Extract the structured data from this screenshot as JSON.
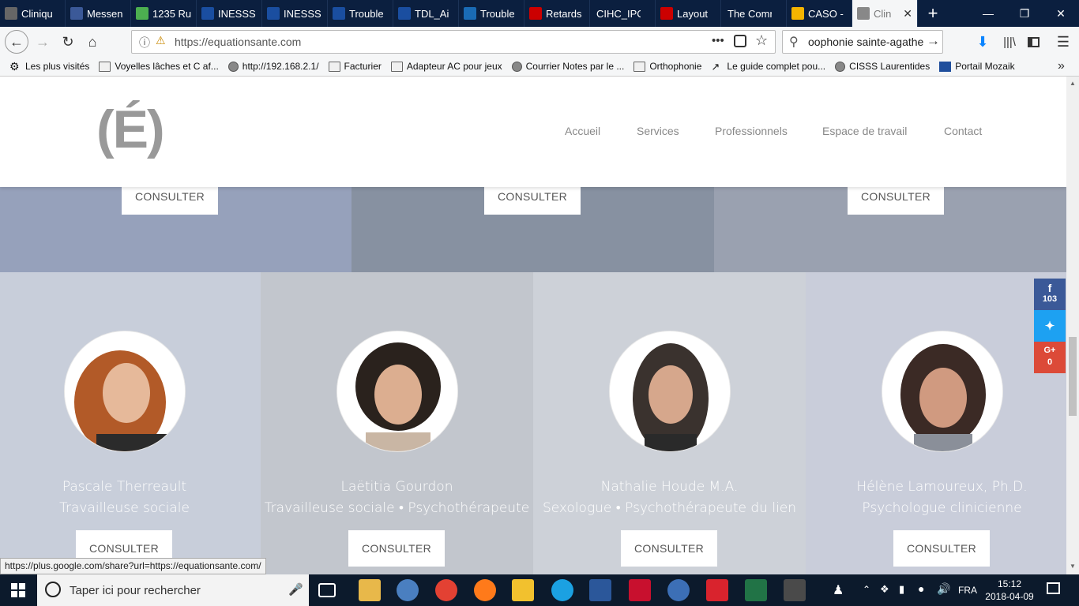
{
  "browser": {
    "tabs": [
      {
        "label": "Cliniqu",
        "icon": "clinic-icon",
        "color": "#666"
      },
      {
        "label": "Messen",
        "icon": "facebook-icon",
        "color": "#3b5998"
      },
      {
        "label": "1235 Ru",
        "icon": "maps-icon",
        "color": "#4caf50"
      },
      {
        "label": "INESSS",
        "icon": "fleurdelis-icon",
        "color": "#1a4ea0"
      },
      {
        "label": "INESSS",
        "icon": "fleurdelis-icon",
        "color": "#1a4ea0"
      },
      {
        "label": "Trouble",
        "icon": "fleurdelis-icon",
        "color": "#1a4ea0"
      },
      {
        "label": "TDL_Ai",
        "icon": "fleurdelis-icon",
        "color": "#1a4ea0"
      },
      {
        "label": "Trouble",
        "icon": "doc-icon",
        "color": "#1a6bb5"
      },
      {
        "label": "Retards",
        "icon": "shield-icon",
        "color": "#c00"
      },
      {
        "label": "CIHC_IPCor",
        "icon": "",
        "color": ""
      },
      {
        "label": "Layout",
        "icon": "crest-icon",
        "color": "#c00"
      },
      {
        "label": "The Comm",
        "icon": "",
        "color": ""
      },
      {
        "label": "CASO -",
        "icon": "drive-icon",
        "color": "#f4b400"
      },
      {
        "label": "Clin",
        "icon": "clinic-icon",
        "color": "#888"
      }
    ],
    "url": "https://equationsante.com",
    "search_value": "оophonie sainte-agathe",
    "bookmarks": [
      {
        "label": "Les plus visités",
        "type": "gear"
      },
      {
        "label": "Voyelles lâches et C af...",
        "type": "folder"
      },
      {
        "label": "http://192.168.2.1/",
        "type": "globe"
      },
      {
        "label": "Facturier",
        "type": "folder"
      },
      {
        "label": "Adapteur AC pour jeux",
        "type": "folder"
      },
      {
        "label": "Courrier Notes par le ...",
        "type": "globe"
      },
      {
        "label": "Orthophonie",
        "type": "folder"
      },
      {
        "label": "Le guide complet pou...",
        "type": "chart"
      },
      {
        "label": "CISSS Laurentides",
        "type": "globe"
      },
      {
        "label": "Portail Mozaik",
        "type": "par"
      }
    ]
  },
  "site": {
    "logo": "(É)",
    "menu": [
      "Accueil",
      "Services",
      "Professionnels",
      "Espace de travail",
      "Contact"
    ],
    "consult_label": "CONSULTER",
    "top_colors": [
      "#96a1bb",
      "#8791a1",
      "#9aa1b0"
    ],
    "team_colors": [
      "#c8ceda",
      "#c2c6cd",
      "#cdd1d8",
      "#c9cdda"
    ],
    "team": [
      {
        "name": "Pascale Therreault",
        "role": "Travailleuse sociale"
      },
      {
        "name": "Laëtitia Gourdon",
        "role": "Travailleuse sociale • Psychothérapeute"
      },
      {
        "name": "Nathalie Houde M.A.",
        "role": "Sexologue • Psychothérapeute du lien"
      },
      {
        "name": "Hélène Lamoureux, Ph.D.",
        "role": "Psychologue clinicienne"
      }
    ]
  },
  "social": {
    "facebook_count": "103",
    "google_label": "G+",
    "google_count": "0",
    "colors": {
      "facebook": "#3b5998",
      "twitter": "#1da1f2",
      "google": "#dc4a38"
    }
  },
  "status_link": "https://plus.google.com/share?url=https://equationsante.com/",
  "taskbar": {
    "search_placeholder": "Taper ici pour rechercher",
    "lang": "FRA",
    "time": "15:12",
    "date": "2018-04-09"
  }
}
